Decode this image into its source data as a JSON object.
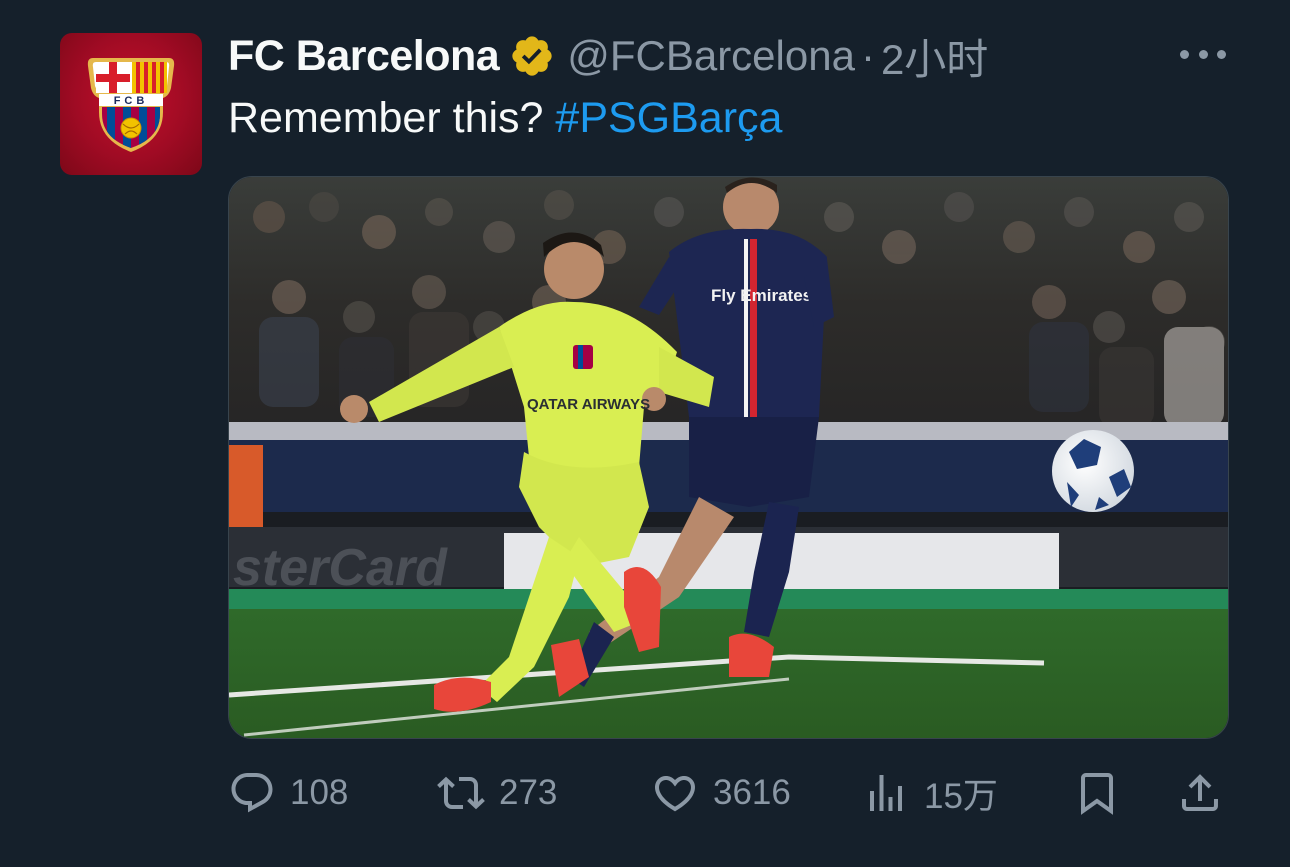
{
  "account": {
    "name": "FC Barcelona",
    "handle": "@FCBarcelona",
    "separator": "·",
    "time": "2小时",
    "avatar_icon": "fc-barcelona-crest",
    "crest_text": "FCB"
  },
  "tweet": {
    "text": "Remember this? ",
    "hashtag": "#PSGBarça"
  },
  "media": {
    "jersey_sponsor": "QATAR AIRWAYS",
    "opponent_sponsor": "Fly Emirates",
    "board_text": "sterCard"
  },
  "actions": {
    "reply": {
      "icon": "reply-icon",
      "count": "108"
    },
    "retweet": {
      "icon": "retweet-icon",
      "count": "273"
    },
    "like": {
      "icon": "heart-icon",
      "count": "3616"
    },
    "views": {
      "icon": "views-icon",
      "count": "15万"
    },
    "bookmark": {
      "icon": "bookmark-icon"
    },
    "share": {
      "icon": "share-icon"
    }
  },
  "colors": {
    "background": "#15202b",
    "text": "#f7f9f9",
    "muted": "#8b98a5",
    "link": "#1d9bf0",
    "verified_gold": "#e2b719",
    "barca_red": "#a50044",
    "barca_blue": "#004d98"
  }
}
